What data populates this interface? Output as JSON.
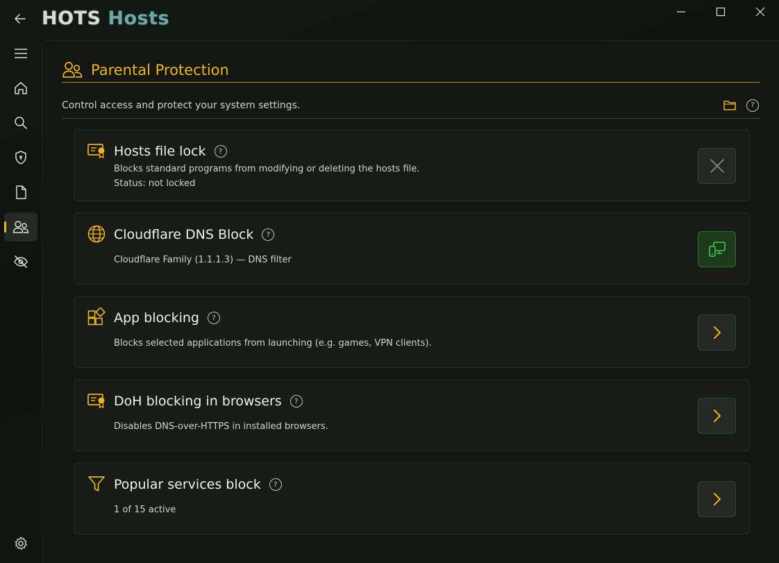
{
  "app": {
    "logo_word1": "HOTS",
    "logo_word2": "Hosts"
  },
  "colors": {
    "accent": "#f2b31c",
    "background": "#121712",
    "card": "#171c17",
    "green_button": "#1d3a1f",
    "green_icon": "#3ecf4a"
  },
  "window_controls": [
    "minimize",
    "maximize",
    "close"
  ],
  "sidebar": {
    "items": [
      {
        "icon": "hamburger-menu-icon"
      },
      {
        "icon": "home-icon"
      },
      {
        "icon": "search-icon"
      },
      {
        "icon": "shield-icon"
      },
      {
        "icon": "document-icon"
      },
      {
        "icon": "parental-users-icon",
        "active": true
      },
      {
        "icon": "hidden-eye-icon"
      },
      {
        "icon": "settings-gear-icon"
      }
    ]
  },
  "page": {
    "title": "Parental Protection",
    "subtitle": "Control access and protect your system settings.",
    "help": "?"
  },
  "cards": [
    {
      "title": "Hosts file lock",
      "desc1": "Blocks standard programs from modifying or deleting the hosts file.",
      "desc2": "Status: not locked",
      "icon": "certificate-icon",
      "action": "close-x"
    },
    {
      "title": "Cloudflare DNS Block",
      "desc1": "Cloudflare Family (1.1.1.3) — DNS filter",
      "icon": "globe-icon",
      "action": "devices-green"
    },
    {
      "title": "App blocking",
      "desc1": "Blocks selected applications from launching (e.g. games, VPN clients).",
      "icon": "apps-grid-icon",
      "action": "chevron-right"
    },
    {
      "title": "DoH blocking in browsers",
      "desc1": "Disables DNS-over-HTTPS in installed browsers.",
      "icon": "certificate-icon",
      "action": "chevron-right"
    },
    {
      "title": "Popular services block",
      "desc1": "1 of 15 active",
      "icon": "filter-funnel-icon",
      "action": "chevron-right"
    }
  ]
}
